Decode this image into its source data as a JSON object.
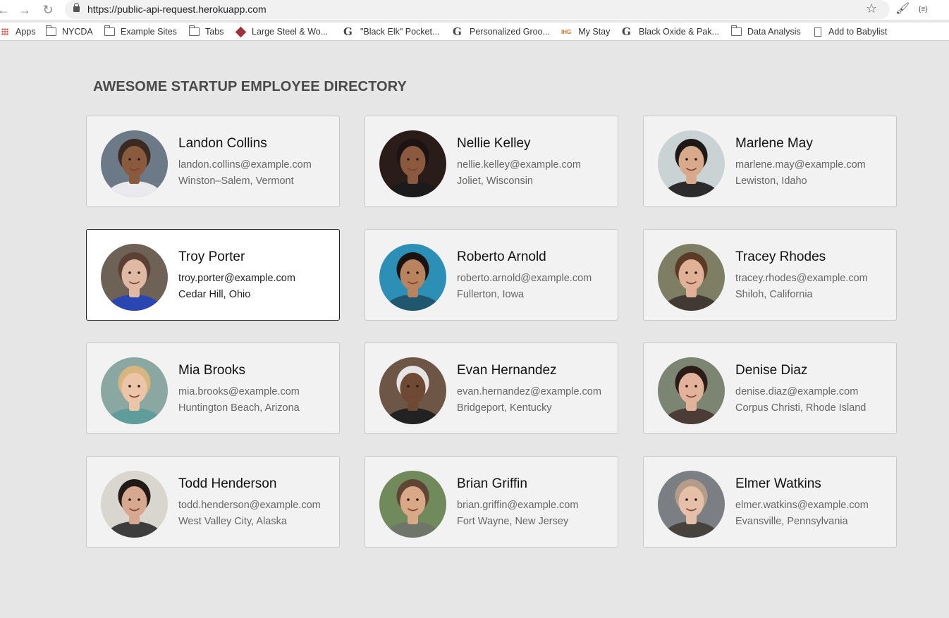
{
  "browser": {
    "url": "https://public-api-request.herokuapp.com",
    "bookmarks": [
      {
        "label": "Apps",
        "icon": "apps-icon"
      },
      {
        "label": "NYCDA",
        "icon": "folder-icon"
      },
      {
        "label": "Example Sites",
        "icon": "folder-icon"
      },
      {
        "label": "Tabs",
        "icon": "folder-icon"
      },
      {
        "label": "Large Steel & Wo...",
        "icon": "site-icon"
      },
      {
        "label": "\"Black Elk\" Pocket...",
        "icon": "google-icon"
      },
      {
        "label": "Personalized Groo...",
        "icon": "google-icon"
      },
      {
        "label": "My Stay",
        "icon": "ihg-icon"
      },
      {
        "label": "Black Oxide & Pak...",
        "icon": "google-icon"
      },
      {
        "label": "Data Analysis",
        "icon": "folder-icon"
      },
      {
        "label": "Add to Babylist",
        "icon": "document-icon"
      }
    ],
    "ihg_text": "IHG",
    "ext_text": "{≡}"
  },
  "page": {
    "title": "AWESOME STARTUP EMPLOYEE DIRECTORY"
  },
  "employees": [
    {
      "name": "Landon Collins",
      "email": "landon.collins@example.com",
      "location": "Winston–Salem, Vermont",
      "skin": "#8a5a3c",
      "hair": "#3a2a22",
      "bg": "#6b7a86",
      "shirt": "#e9e9ee"
    },
    {
      "name": "Nellie Kelley",
      "email": "nellie.kelley@example.com",
      "location": "Joliet, Wisconsin",
      "skin": "#8b5a3e",
      "hair": "#1c1412",
      "bg": "#2a1c18",
      "shirt": "#1b1b1b"
    },
    {
      "name": "Marlene May",
      "email": "marlene.may@example.com",
      "location": "Lewiston, Idaho",
      "skin": "#d9a98c",
      "hair": "#1d1917",
      "bg": "#c9d3d3",
      "shirt": "#2b2b2b"
    },
    {
      "name": "Troy Porter",
      "email": "troy.porter@example.com",
      "location": "Cedar Hill, Ohio",
      "skin": "#e0b9a4",
      "hair": "#5a4134",
      "bg": "#6e6256",
      "shirt": "#2a46b0"
    },
    {
      "name": "Roberto Arnold",
      "email": "roberto.arnold@example.com",
      "location": "Fullerton, Iowa",
      "skin": "#b9835d",
      "hair": "#1a1310",
      "bg": "#2b8fb6",
      "shirt": "#20566e"
    },
    {
      "name": "Tracey Rhodes",
      "email": "tracey.rhodes@example.com",
      "location": "Shiloh, California",
      "skin": "#e0b197",
      "hair": "#5b3a26",
      "bg": "#7d7e64",
      "shirt": "#403a33"
    },
    {
      "name": "Mia Brooks",
      "email": "mia.brooks@example.com",
      "location": "Huntington Beach, Arizona",
      "skin": "#ecc4a7",
      "hair": "#d7b57e",
      "bg": "#8aa7a2",
      "shirt": "#5f9d9a"
    },
    {
      "name": "Evan Hernandez",
      "email": "evan.hernandez@example.com",
      "location": "Bridgeport, Kentucky",
      "skin": "#6e4a35",
      "hair": "#e4e4e4",
      "bg": "#6d5646",
      "shirt": "#222222"
    },
    {
      "name": "Denise Diaz",
      "email": "denise.diaz@example.com",
      "location": "Corpus Christi, Rhode Island",
      "skin": "#e2b29a",
      "hair": "#2a1d18",
      "bg": "#7c8572",
      "shirt": "#4b3c38"
    },
    {
      "name": "Todd Henderson",
      "email": "todd.henderson@example.com",
      "location": "West Valley City, Alaska",
      "skin": "#d6a98f",
      "hair": "#221a17",
      "bg": "#d9d6cf",
      "shirt": "#3d3d3d"
    },
    {
      "name": "Brian Griffin",
      "email": "brian.griffin@example.com",
      "location": "Fort Wayne, New Jersey",
      "skin": "#d8a887",
      "hair": "#5e4534",
      "bg": "#718a5b",
      "shirt": "#6f7569"
    },
    {
      "name": "Elmer Watkins",
      "email": "elmer.watkins@example.com",
      "location": "Evansville, Pennsylvania",
      "skin": "#e6bfa8",
      "hair": "#b39c88",
      "bg": "#7b7f83",
      "shirt": "#46433f"
    }
  ],
  "selected_index": 3
}
